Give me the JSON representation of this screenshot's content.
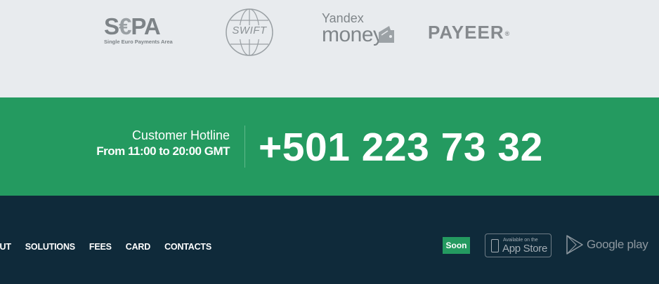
{
  "payment_logos": {
    "sepa": {
      "word_pre": "S",
      "word_euro": "€",
      "word_post": "PA",
      "subtitle": "Single Euro Payments Area"
    },
    "swift": {
      "label": "SWIFT"
    },
    "yandex_money": {
      "top": "Yandex",
      "bottom": "money"
    },
    "payeer": {
      "label": "PAYEER",
      "mark": "®"
    }
  },
  "hotline": {
    "title": "Customer Hotline",
    "hours": "From 11:00 to 20:00 GMT",
    "phone": "+501 223 73 32",
    "background_color": "#249a60"
  },
  "footer": {
    "nav": [
      "OUT",
      "SOLUTIONS",
      "FEES",
      "CARD",
      "CONTACTS"
    ],
    "soon_badge": "Soon",
    "app_store": {
      "small": "Available on the",
      "big": "App Store"
    },
    "google_play": {
      "label": "Google play"
    },
    "background_color": "#0f2a3a"
  }
}
